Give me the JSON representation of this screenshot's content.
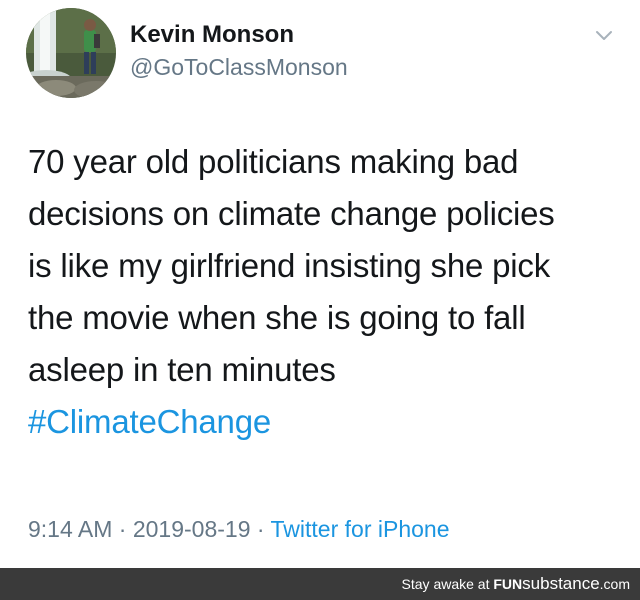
{
  "tweet": {
    "author": {
      "display_name": "Kevin Monson",
      "handle": "@GoToClassMonson",
      "avatar_icon": "avatar-photo-waterfall"
    },
    "menu_icon": "chevron-down-icon",
    "text_lines": [
      "70 year old politicians making bad",
      "decisions on climate change policies",
      "is like my girlfriend insisting she pick",
      "the movie when she is going to fall",
      "asleep in ten minutes"
    ],
    "hashtag": "#ClimateChange",
    "time": "9:14 AM",
    "date": "2019-08-19",
    "separator": " · ",
    "source": "Twitter for iPhone"
  },
  "watermark": {
    "prefix": "Stay awake at ",
    "brand_bold": "FUN",
    "brand_light": "substance",
    "brand_suffix": ".com"
  },
  "colors": {
    "text": "#14171a",
    "secondary": "#657786",
    "link": "#1b95e0",
    "footer_bg": "#3a3a3a"
  }
}
